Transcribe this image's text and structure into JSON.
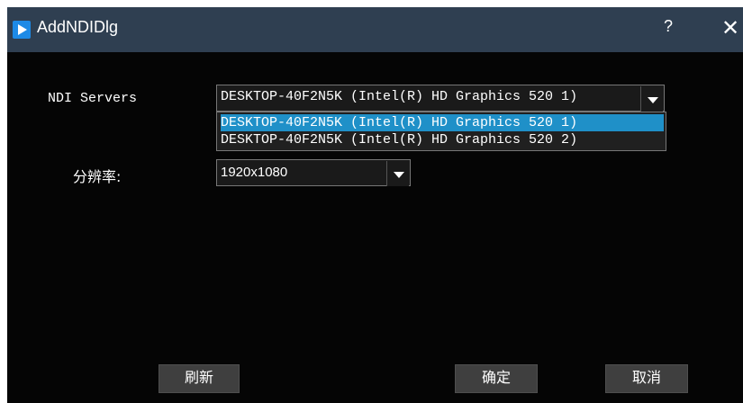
{
  "window": {
    "title": "AddNDIDlg",
    "help_label": "?",
    "close_label": "✕"
  },
  "ndi": {
    "label": "NDI Servers",
    "selected": "DESKTOP-40F2N5K (Intel(R) HD Graphics 520 1)",
    "options": [
      "DESKTOP-40F2N5K (Intel(R) HD Graphics 520 1)",
      "DESKTOP-40F2N5K (Intel(R) HD Graphics 520 2)"
    ]
  },
  "resolution": {
    "label": "分辨率:",
    "selected": "1920x1080"
  },
  "buttons": {
    "refresh": "刷新",
    "ok": "确定",
    "cancel": "取消"
  }
}
